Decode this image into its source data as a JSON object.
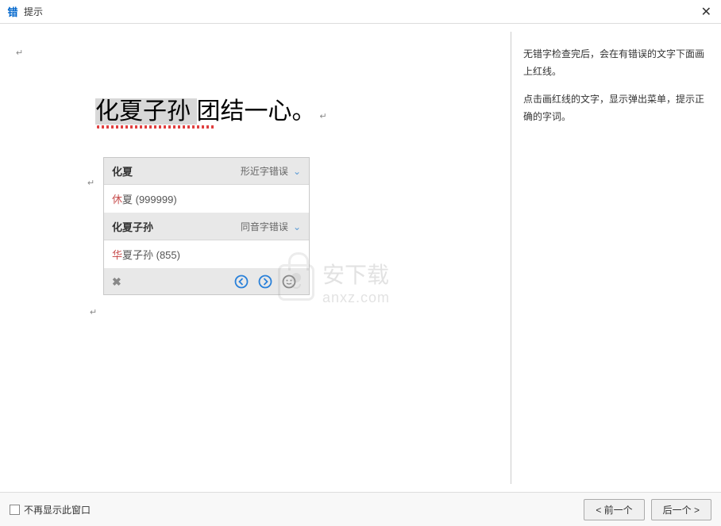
{
  "window": {
    "icon_text": "错",
    "title": "提示"
  },
  "document": {
    "text_highlighted": "化夏子孙",
    "text_rest": "团结一心。"
  },
  "popup": {
    "sections": [
      {
        "label": "化夏",
        "error_type": "形近字错误",
        "suggestion_char": "休",
        "suggestion_rest": "夏 (999999)"
      },
      {
        "label": "化夏子孙",
        "error_type": "同音字错误",
        "suggestion_char": "华",
        "suggestion_rest": "夏子孙 (855)"
      }
    ]
  },
  "tips": {
    "line1": "无错字检查完后，会在有错误的文字下面画上红线。",
    "line2": "点击画红线的文字，显示弹出菜单，提示正确的字词。"
  },
  "watermark": {
    "cn": "安下载",
    "en": "anxz.com"
  },
  "footer": {
    "checkbox_label": "不再显示此窗口",
    "prev_button": "< 前一个",
    "next_button": "后一个 >"
  }
}
